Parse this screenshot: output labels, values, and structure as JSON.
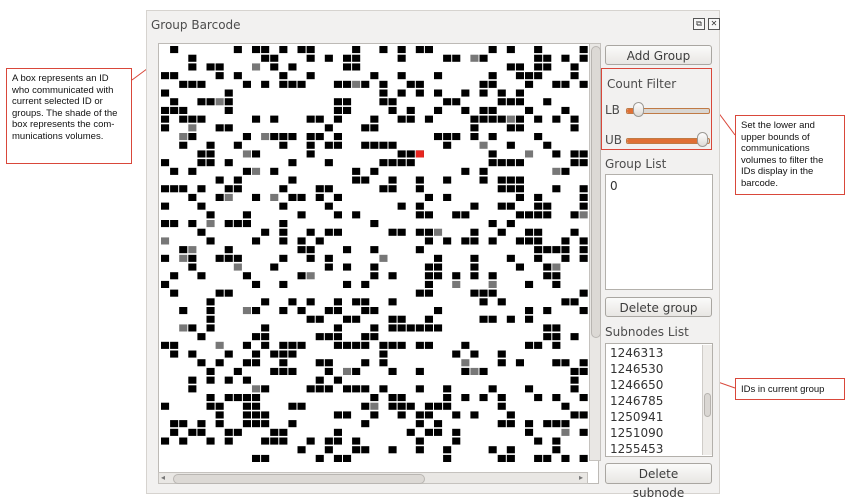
{
  "panel": {
    "title": "Group Barcode",
    "float_icon": "⧉",
    "close_icon": "✕"
  },
  "barcode": {
    "cols": 47,
    "rows": 48,
    "fill_ratio": 0.3,
    "colors": {
      "box": "#000000",
      "highlight": "#e8251f",
      "light_box": "#777777"
    }
  },
  "buttons": {
    "add_group": "Add Group",
    "delete_group": "Delete group",
    "delete_subnode": "Delete subnode"
  },
  "count_filter": {
    "title": "Count Filter",
    "lb_label": "LB",
    "ub_label": "UB",
    "lb_value": 0.1,
    "ub_value": 1.0
  },
  "group_list": {
    "title": "Group List",
    "items": [
      "0"
    ]
  },
  "subnodes_list": {
    "title": "Subnodes List",
    "items": [
      "1246313",
      "1246530",
      "1246650",
      "1246785",
      "1250941",
      "1251090",
      "1255453"
    ]
  },
  "annotations": {
    "box_note": "A box represents an ID who communicated with current selected ID or groups. The shade of the box represents the com-munications volumes.",
    "filter_note": "Set the lower and upper bounds of communications volumes to filter the IDs display in the barcode.",
    "ids_note": "IDs in current group"
  },
  "colors": {
    "annotation_border": "#d9473a",
    "slider_fill": "#e07035"
  }
}
